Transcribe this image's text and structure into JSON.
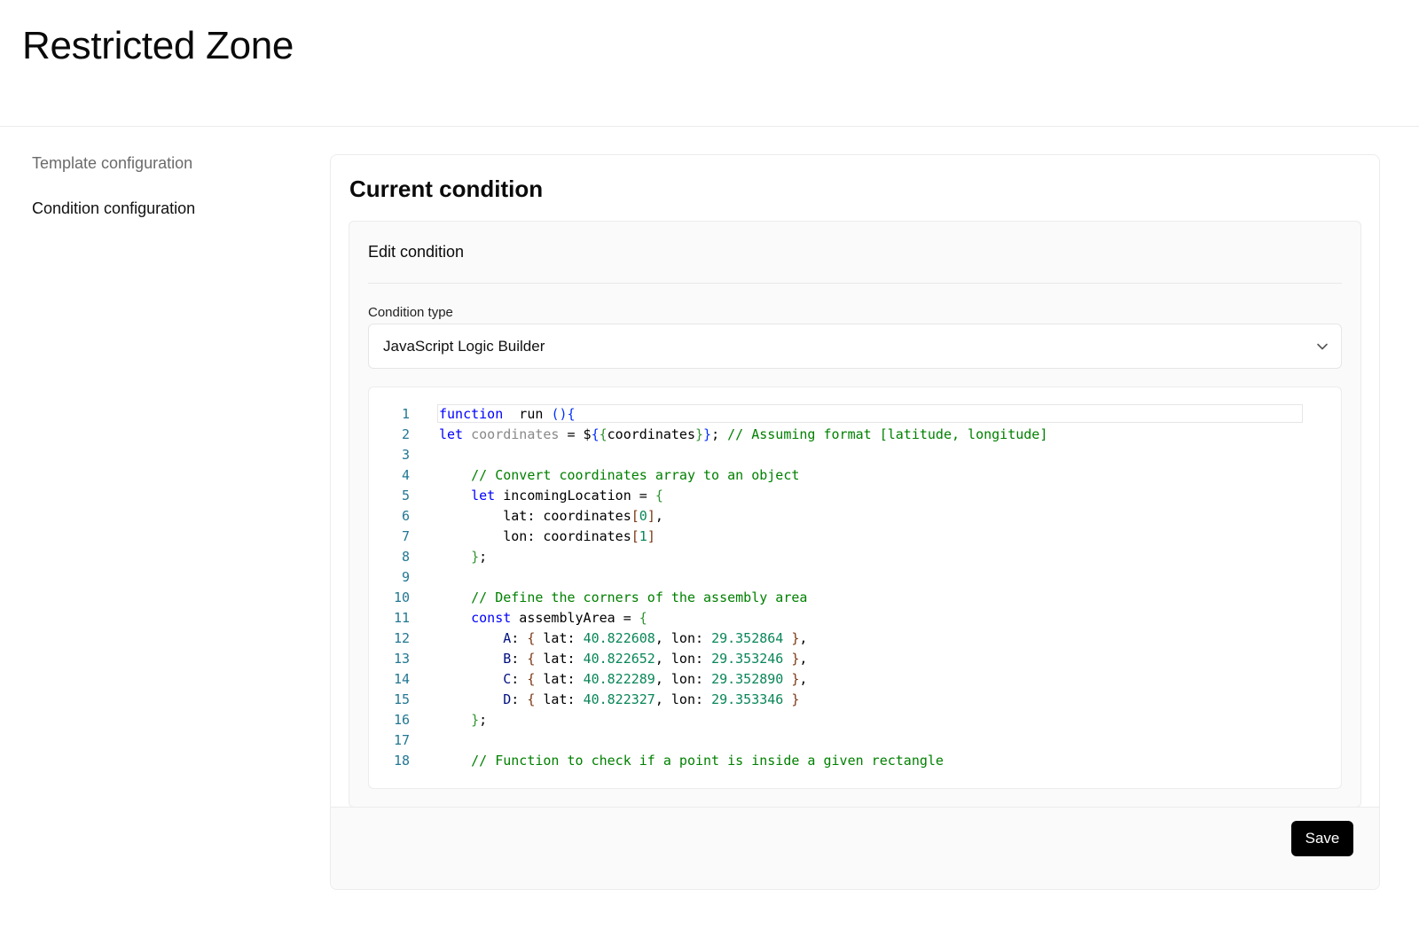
{
  "page": {
    "title": "Restricted Zone"
  },
  "sidebar": {
    "items": [
      {
        "label": "Template configuration",
        "active": false
      },
      {
        "label": "Condition configuration",
        "active": true
      }
    ]
  },
  "card": {
    "title": "Current condition",
    "panel": {
      "title": "Edit condition",
      "condition_type_label": "Condition type",
      "condition_type_value": "JavaScript Logic Builder"
    },
    "save_label": "Save"
  },
  "editor": {
    "language": "javascript",
    "current_line": 1,
    "lines": [
      {
        "n": "1",
        "tokens": [
          [
            "kw",
            "function"
          ],
          [
            "",
            "  run "
          ],
          [
            "br1",
            "(){"
          ]
        ]
      },
      {
        "n": "2",
        "tokens": [
          [
            "kw",
            "let"
          ],
          [
            "",
            " "
          ],
          [
            "var",
            "coordinates"
          ],
          [
            "",
            " = $"
          ],
          [
            "br1",
            "{"
          ],
          [
            "br2",
            "{"
          ],
          [
            "",
            "coordinates"
          ],
          [
            "br2",
            "}"
          ],
          [
            "br1",
            "}"
          ],
          [
            "",
            "; "
          ],
          [
            "cm",
            "// Assuming format [latitude, longitude]"
          ]
        ]
      },
      {
        "n": "3",
        "tokens": []
      },
      {
        "n": "4",
        "tokens": [
          [
            "",
            "    "
          ],
          [
            "cm",
            "// Convert coordinates array to an object"
          ]
        ]
      },
      {
        "n": "5",
        "tokens": [
          [
            "",
            "    "
          ],
          [
            "kw",
            "let"
          ],
          [
            "",
            " incomingLocation = "
          ],
          [
            "br2",
            "{"
          ]
        ]
      },
      {
        "n": "6",
        "tokens": [
          [
            "",
            "        lat: coordinates"
          ],
          [
            "br3",
            "["
          ],
          [
            "num",
            "0"
          ],
          [
            "br3",
            "]"
          ],
          [
            "",
            ","
          ]
        ]
      },
      {
        "n": "7",
        "tokens": [
          [
            "",
            "        lon: coordinates"
          ],
          [
            "br3",
            "["
          ],
          [
            "num",
            "1"
          ],
          [
            "br3",
            "]"
          ]
        ]
      },
      {
        "n": "8",
        "tokens": [
          [
            "",
            "    "
          ],
          [
            "br2",
            "}"
          ],
          [
            "",
            ";"
          ]
        ]
      },
      {
        "n": "9",
        "tokens": []
      },
      {
        "n": "10",
        "tokens": [
          [
            "",
            "    "
          ],
          [
            "cm",
            "// Define the corners of the assembly area"
          ]
        ]
      },
      {
        "n": "11",
        "tokens": [
          [
            "",
            "    "
          ],
          [
            "kw",
            "const"
          ],
          [
            "",
            " assemblyArea = "
          ],
          [
            "br2",
            "{"
          ]
        ]
      },
      {
        "n": "12",
        "tokens": [
          [
            "",
            "        "
          ],
          [
            "prop",
            "A"
          ],
          [
            "",
            ": "
          ],
          [
            "br3",
            "{"
          ],
          [
            "",
            ""
          ],
          [
            "",
            " lat: "
          ],
          [
            "num",
            "40.822608"
          ],
          [
            "",
            ", lon: "
          ],
          [
            "num",
            "29.352864"
          ],
          [
            "",
            " "
          ],
          [
            "br3",
            "}"
          ],
          [
            "",
            ","
          ]
        ]
      },
      {
        "n": "13",
        "tokens": [
          [
            "",
            "        "
          ],
          [
            "prop",
            "B"
          ],
          [
            "",
            ": "
          ],
          [
            "br3",
            "{"
          ],
          [
            "",
            " lat: "
          ],
          [
            "num",
            "40.822652"
          ],
          [
            "",
            ", lon: "
          ],
          [
            "num",
            "29.353246"
          ],
          [
            "",
            " "
          ],
          [
            "br3",
            "}"
          ],
          [
            "",
            ","
          ]
        ]
      },
      {
        "n": "14",
        "tokens": [
          [
            "",
            "        "
          ],
          [
            "prop",
            "C"
          ],
          [
            "",
            ": "
          ],
          [
            "br3",
            "{"
          ],
          [
            "",
            " lat: "
          ],
          [
            "num",
            "40.822289"
          ],
          [
            "",
            ", lon: "
          ],
          [
            "num",
            "29.352890"
          ],
          [
            "",
            " "
          ],
          [
            "br3",
            "}"
          ],
          [
            "",
            ","
          ]
        ]
      },
      {
        "n": "15",
        "tokens": [
          [
            "",
            "        "
          ],
          [
            "prop",
            "D"
          ],
          [
            "",
            ": "
          ],
          [
            "br3",
            "{"
          ],
          [
            "",
            " lat: "
          ],
          [
            "num",
            "40.822327"
          ],
          [
            "",
            ", lon: "
          ],
          [
            "num",
            "29.353346"
          ],
          [
            "",
            " "
          ],
          [
            "br3",
            "}"
          ]
        ]
      },
      {
        "n": "16",
        "tokens": [
          [
            "",
            "    "
          ],
          [
            "br2",
            "}"
          ],
          [
            "",
            ";"
          ]
        ]
      },
      {
        "n": "17",
        "tokens": []
      },
      {
        "n": "18",
        "tokens": [
          [
            "",
            "    "
          ],
          [
            "cm",
            "// Function to check if a point is inside a given rectangle"
          ]
        ]
      }
    ]
  },
  "icons": {
    "select_arrow": "chevron-down-icon"
  },
  "colors": {
    "primary_button": "#000000",
    "keyword": "#0000ff",
    "comment": "#008000",
    "number": "#098658"
  }
}
